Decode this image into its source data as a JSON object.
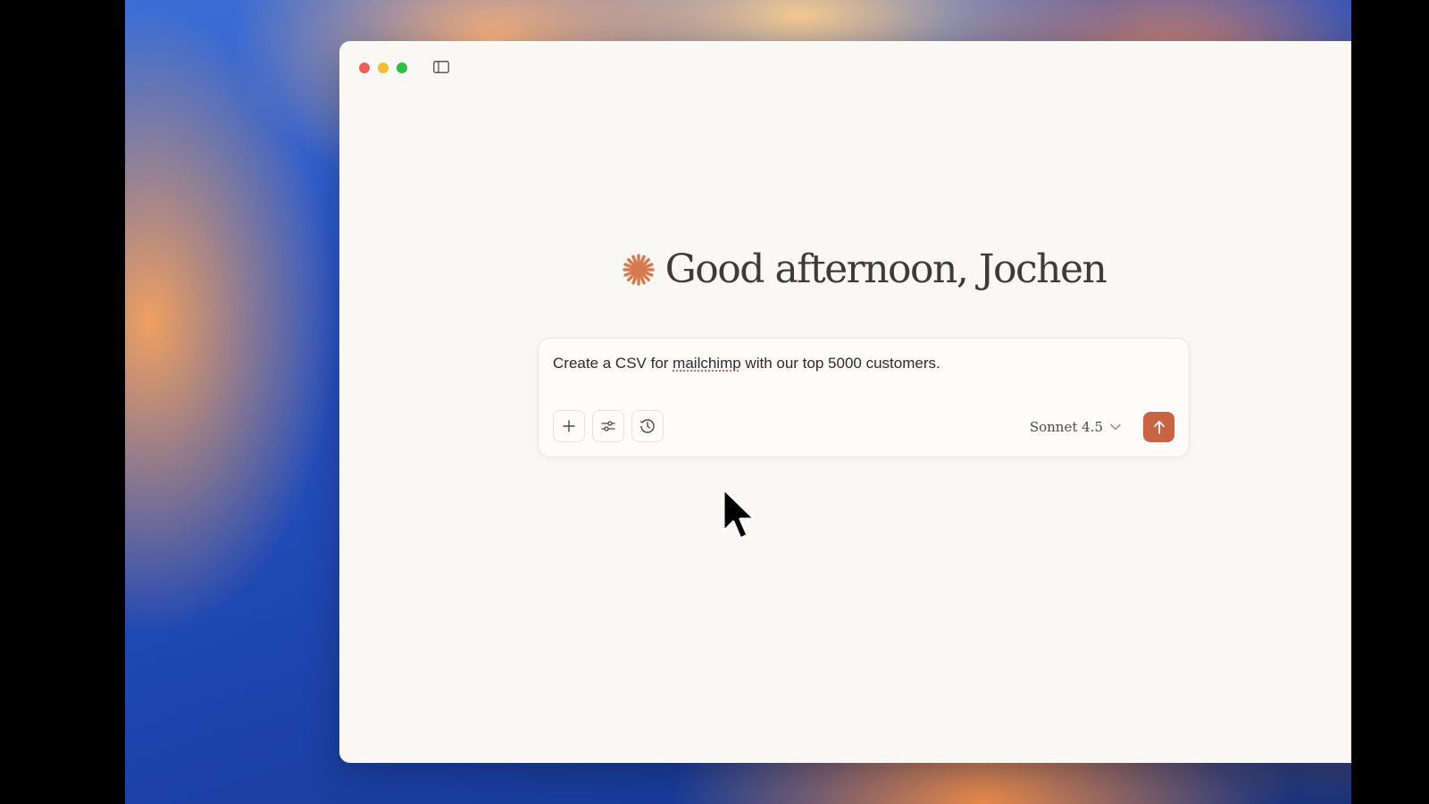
{
  "app": {
    "greeting": "Good afternoon, Jochen"
  },
  "composer": {
    "text_before": "Create a CSV for ",
    "text_flagged": "mailchimp",
    "text_after": " with our top 5000 customers."
  },
  "toolbar": {
    "icons": [
      "plus-icon",
      "sliders-icon",
      "clock-icon"
    ]
  },
  "model_selector": {
    "value": "Sonnet 4.5"
  },
  "colors": {
    "accent": "#c96442",
    "window_bg": "#faf8f4",
    "text": "#3d3b38"
  }
}
